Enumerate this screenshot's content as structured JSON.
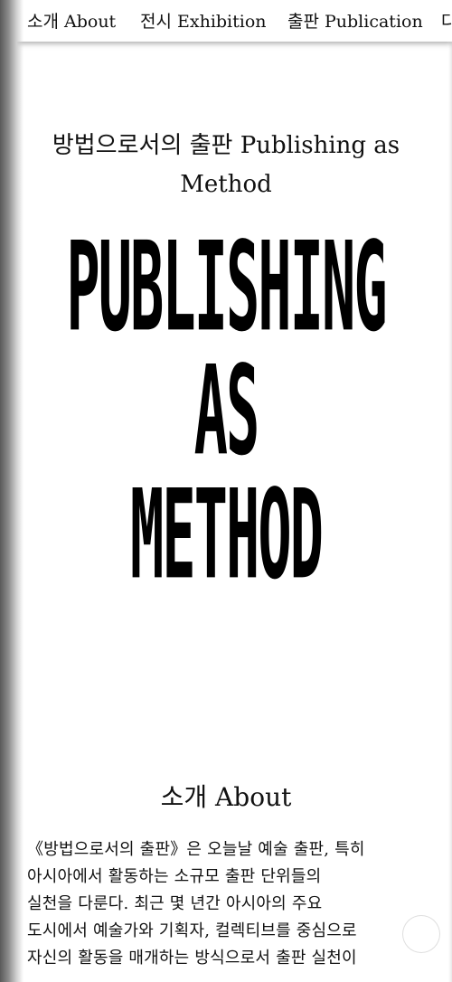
{
  "nav": {
    "items": [
      {
        "label": "소개 About"
      },
      {
        "label": "전시 Exhibition"
      },
      {
        "label": "출판 Publication"
      },
      {
        "label": "다"
      }
    ]
  },
  "header": {
    "subtitle_line1": "방법으로서의 출판 Publishing as",
    "subtitle_line2": "Method"
  },
  "poster": {
    "line1": "PUBLISHING",
    "line2": "AS",
    "line3": "METHOD"
  },
  "about": {
    "heading": "소개 About",
    "lines": [
      "《방법으로서의 출판》은 오늘날 예술 출판, 특히",
      "아시아에서 활동하는 소규모 출판 단위들의",
      "실천을 다룬다. 최근 몇 년간 아시아의 주요",
      "도시에서 예술가와 기획자, 컬렉티브를 중심으로",
      "자신의 활동을 매개하는 방식으로서 출판 실천이"
    ]
  }
}
